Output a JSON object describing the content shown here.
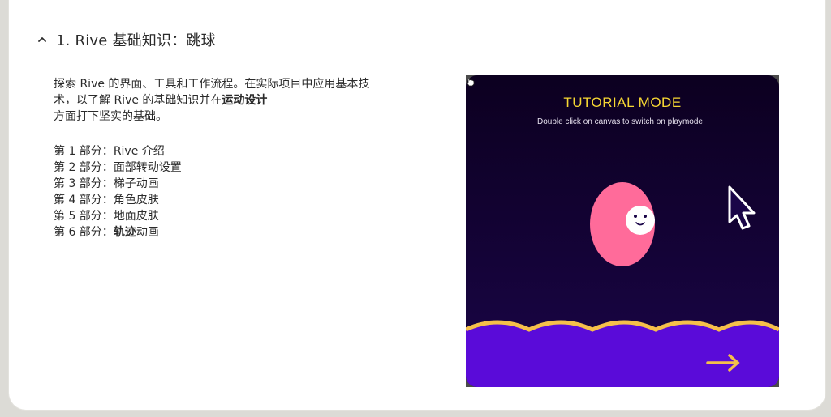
{
  "section": {
    "title": "1. Rive 基础知识：跳球",
    "expanded": true,
    "toggle_icon": "chevron-up-icon"
  },
  "description": {
    "part1": "探索 Rive 的界面、工具和工作流程。在实际项目中应用基本技术，以了解 Rive 的基础知识并在",
    "bold": "运动设计",
    "part2": "方面打下坚实的基础。"
  },
  "parts": [
    {
      "prefix": "第 1 部分：",
      "text": "Rive 介绍"
    },
    {
      "prefix": "第 2 部分：",
      "text": "面部转动设置"
    },
    {
      "prefix": "第 3 部分：",
      "text": "梯子动画"
    },
    {
      "prefix": "第 4 部分：",
      "text": "角色皮肤"
    },
    {
      "prefix": "第 5 部分：",
      "text": "地面皮肤"
    },
    {
      "prefix": "第 6 部分：",
      "bold": "轨迹",
      "text": "动画"
    }
  ],
  "canvas": {
    "mode_title": "TUTORIAL MODE",
    "hint": "Double click on canvas to switch on playmode",
    "colors": {
      "background_top": "#0c0020",
      "background_bottom": "#1a0548",
      "title": "#f7d733",
      "ball": "#ff6b9a",
      "ground": "#5a0bd9",
      "ground_edge": "#f5c04a",
      "arrow": "#f5c04a"
    },
    "icons": [
      "hand-pointer-icon",
      "cursor-arrow-icon",
      "arrow-right-icon"
    ]
  }
}
